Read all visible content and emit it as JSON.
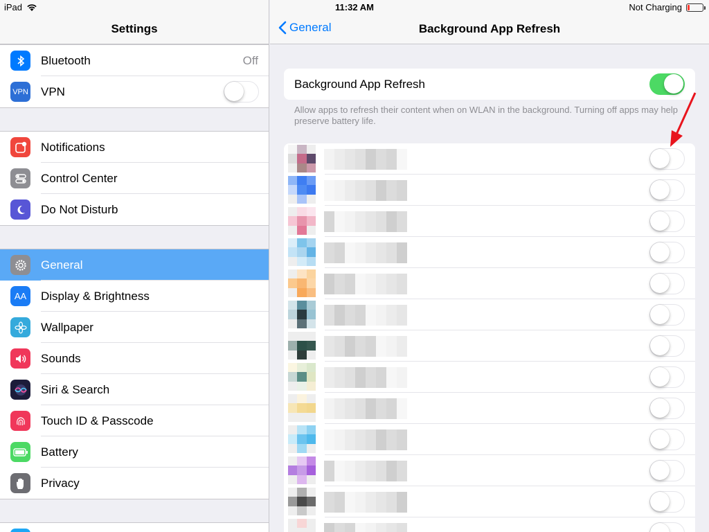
{
  "status_bar": {
    "device": "iPad",
    "time": "11:32 AM",
    "charging": "Not Charging",
    "icons": [
      "wifi-icon",
      "battery-icon"
    ]
  },
  "sidebar": {
    "title": "Settings",
    "groups": [
      [
        {
          "label": "Bluetooth",
          "value": "Off",
          "icon": "bluetooth-icon",
          "color": "#007aff"
        },
        {
          "label": "VPN",
          "toggle": false,
          "icon": "vpn-icon",
          "icon_text": "VPN",
          "color": "#2d6fd6"
        }
      ],
      [
        {
          "label": "Notifications",
          "icon": "notifications-icon",
          "color": "#f0463c"
        },
        {
          "label": "Control Center",
          "icon": "control-center-icon",
          "color": "#8e8e93"
        },
        {
          "label": "Do Not Disturb",
          "icon": "moon-icon",
          "color": "#5856d6"
        }
      ],
      [
        {
          "label": "General",
          "icon": "gear-icon",
          "color": "#8e8e93",
          "selected": true
        },
        {
          "label": "Display & Brightness",
          "icon": "display-icon",
          "icon_text": "AA",
          "color": "#1a7cf5"
        },
        {
          "label": "Wallpaper",
          "icon": "wallpaper-icon",
          "color": "#35aadc"
        },
        {
          "label": "Sounds",
          "icon": "speaker-icon",
          "color": "#f0375a"
        },
        {
          "label": "Siri & Search",
          "icon": "siri-icon",
          "color": "#1c1c3a"
        },
        {
          "label": "Touch ID & Passcode",
          "icon": "fingerprint-icon",
          "color": "#f0375a"
        },
        {
          "label": "Battery",
          "icon": "battery-icon",
          "color": "#4cd964"
        },
        {
          "label": "Privacy",
          "icon": "hand-icon",
          "color": "#6d6d72"
        }
      ]
    ]
  },
  "detail": {
    "back_label": "General",
    "title": "Background App Refresh",
    "main_toggle": {
      "label": "Background App Refresh",
      "on": true
    },
    "note": "Allow apps to refresh their content when on WLAN in the background. Turning off apps may help preserve battery life.",
    "app_rows": [
      {
        "toggle": false,
        "icon_colors": [
          "#f5f5f5",
          "#c9b6c4",
          "#eee",
          "#ddd",
          "#c46b8a",
          "#5e4a6b",
          "#eee",
          "#a88",
          "#c9a"
        ]
      },
      {
        "toggle": false,
        "icon_colors": [
          "#8fb6f7",
          "#3f7ef2",
          "#6b9cf5",
          "#c5d8fb",
          "#4e8bf3",
          "#3d7af0",
          "#eee",
          "#a9c4f9",
          "#eee"
        ]
      },
      {
        "toggle": false,
        "icon_colors": [
          "#eee",
          "#f9dbe5",
          "#fbe5ee",
          "#f6c6d4",
          "#e894ac",
          "#f2b7c8",
          "#eee",
          "#e27897",
          "#eee"
        ]
      },
      {
        "toggle": false,
        "icon_colors": [
          "#dbeef9",
          "#7ec4ea",
          "#a5d4f0",
          "#c3e3f6",
          "#aad5ef",
          "#63b3e5",
          "#eee",
          "#d3ebf8",
          "#b7ddf3"
        ]
      },
      {
        "toggle": false,
        "icon_colors": [
          "#eee",
          "#fde3c3",
          "#fbd49f",
          "#fbc98d",
          "#f9b772",
          "#fcd7a8",
          "#eee",
          "#f8a95a",
          "#f9be81"
        ]
      },
      {
        "toggle": false,
        "icon_colors": [
          "#d3e4ea",
          "#5b8e9d",
          "#a9cbd6",
          "#bcd4dc",
          "#2a3b40",
          "#98c3d3",
          "#eee",
          "#5c7178",
          "#d4e4ea"
        ]
      },
      {
        "toggle": false,
        "icon_colors": [
          "#eee",
          "#eee",
          "#eee",
          "#9db0ad",
          "#2d5048",
          "#36574f",
          "#eee",
          "#2e3d3a",
          "#eee"
        ]
      },
      {
        "toggle": false,
        "icon_colors": [
          "#fbf6e1",
          "#e7efd9",
          "#dae8cc",
          "#c7d7d4",
          "#5b8e86",
          "#dfe6c3",
          "#eee",
          "#eaf1e8",
          "#f5eed4"
        ]
      },
      {
        "toggle": false,
        "icon_colors": [
          "#eee",
          "#fbf3df",
          "#eee",
          "#f7e6b6",
          "#f4da94",
          "#f2d78d",
          "#eee",
          "#eee",
          "#eee"
        ]
      },
      {
        "toggle": false,
        "icon_colors": [
          "#eee",
          "#b8e3f6",
          "#8ed2f2",
          "#c9ebf9",
          "#6cc4ef",
          "#4fb9ec",
          "#eee",
          "#a0d9f4",
          "#eee"
        ]
      },
      {
        "toggle": false,
        "icon_colors": [
          "#eee",
          "#e6c9f3",
          "#c48ae6",
          "#b47ee0",
          "#c79be7",
          "#a660dc",
          "#eee",
          "#ddb7ef",
          "#eee"
        ]
      },
      {
        "toggle": false,
        "icon_colors": [
          "#eee",
          "#b0b0b0",
          "#eee",
          "#9a9a9a",
          "#4a4a4a",
          "#6b6b6b",
          "#eee",
          "#c9c9c9",
          "#eee"
        ]
      },
      {
        "toggle": false,
        "icon_colors": [
          "#eee",
          "#f8d6d6",
          "#eee",
          "#eee",
          "#eee",
          "#eee",
          "#eee",
          "#eee",
          "#eee"
        ]
      }
    ]
  }
}
